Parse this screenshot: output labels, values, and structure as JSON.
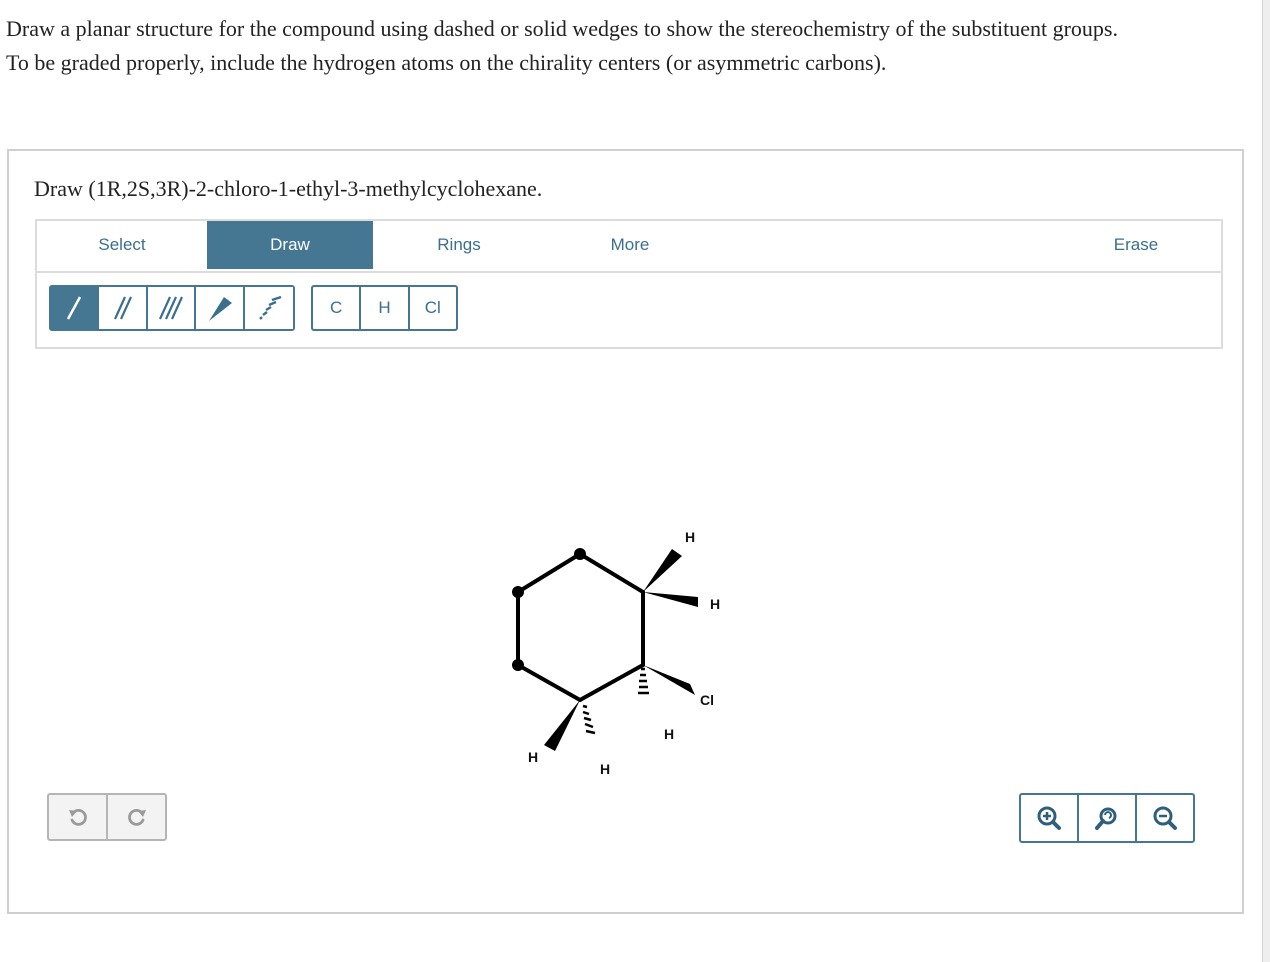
{
  "instructions": {
    "line1": "Draw a planar structure for the compound using dashed or solid wedges to show the stereochemistry of the substituent groups.",
    "line2": "To be graded properly, include the hydrogen atoms on the chirality centers (or asymmetric carbons)."
  },
  "question": {
    "text": "Draw (1R,2S,3R)-2-chloro-1-ethyl-3-methylcyclohexane."
  },
  "tabs": [
    {
      "label": "Select",
      "active": false
    },
    {
      "label": "Draw",
      "active": true
    },
    {
      "label": "Rings",
      "active": false
    },
    {
      "label": "More",
      "active": false
    },
    {
      "label": "Erase",
      "active": false
    }
  ],
  "bond_tools": [
    {
      "icon": "single-bond-icon",
      "active": true
    },
    {
      "icon": "double-bond-icon",
      "active": false
    },
    {
      "icon": "triple-bond-icon",
      "active": false
    },
    {
      "icon": "wedge-bond-icon",
      "active": false
    },
    {
      "icon": "dash-bond-icon",
      "active": false
    }
  ],
  "atom_tools": [
    {
      "label": "C"
    },
    {
      "label": "H"
    },
    {
      "label": "Cl"
    }
  ],
  "molecule": {
    "labels": {
      "h_top": "H",
      "h_right": "H",
      "cl": "Cl",
      "h_mid": "H",
      "h_left": "H",
      "h_bottom": "H"
    }
  },
  "colors": {
    "accent": "#457792",
    "tab_text": "#3b6f8e",
    "border": "#cfcfcf"
  }
}
